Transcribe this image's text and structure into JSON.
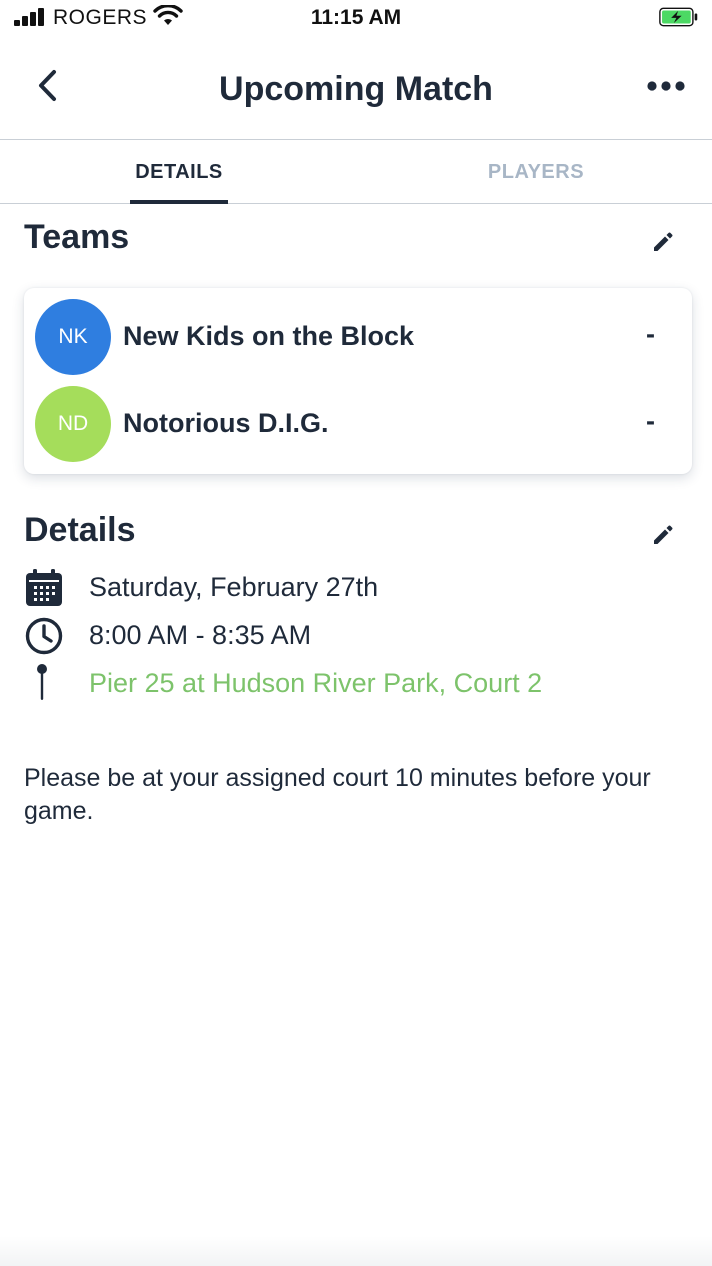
{
  "status_bar": {
    "carrier": "ROGERS",
    "time": "11:15 AM"
  },
  "nav": {
    "title": "Upcoming Match",
    "back_icon": "chevron-left-icon",
    "more_icon": "more-dots-icon"
  },
  "tabs": [
    {
      "label": "DETAILS",
      "active": true
    },
    {
      "label": "PLAYERS",
      "active": false
    }
  ],
  "teams_section": {
    "title": "Teams",
    "edit_icon": "pencil-icon",
    "teams": [
      {
        "initials": "NK",
        "name": "New Kids on the Block",
        "score": "-",
        "color": "#2f7ee0"
      },
      {
        "initials": "ND",
        "name": "Notorious D.I.G.",
        "score": "-",
        "color": "#a5dd5b"
      }
    ]
  },
  "details_section": {
    "title": "Details",
    "edit_icon": "pencil-icon",
    "date": "Saturday, February 27th",
    "time": "8:00 AM - 8:35 AM",
    "location": "Pier 25 at Hudson River Park, Court 2"
  },
  "note": "Please be at your assigned court 10 minutes before your game.",
  "colors": {
    "text_primary": "#1f2a3a",
    "tab_inactive": "#a8b6c6",
    "link": "#7dc36b",
    "battery": "#4cd964"
  }
}
